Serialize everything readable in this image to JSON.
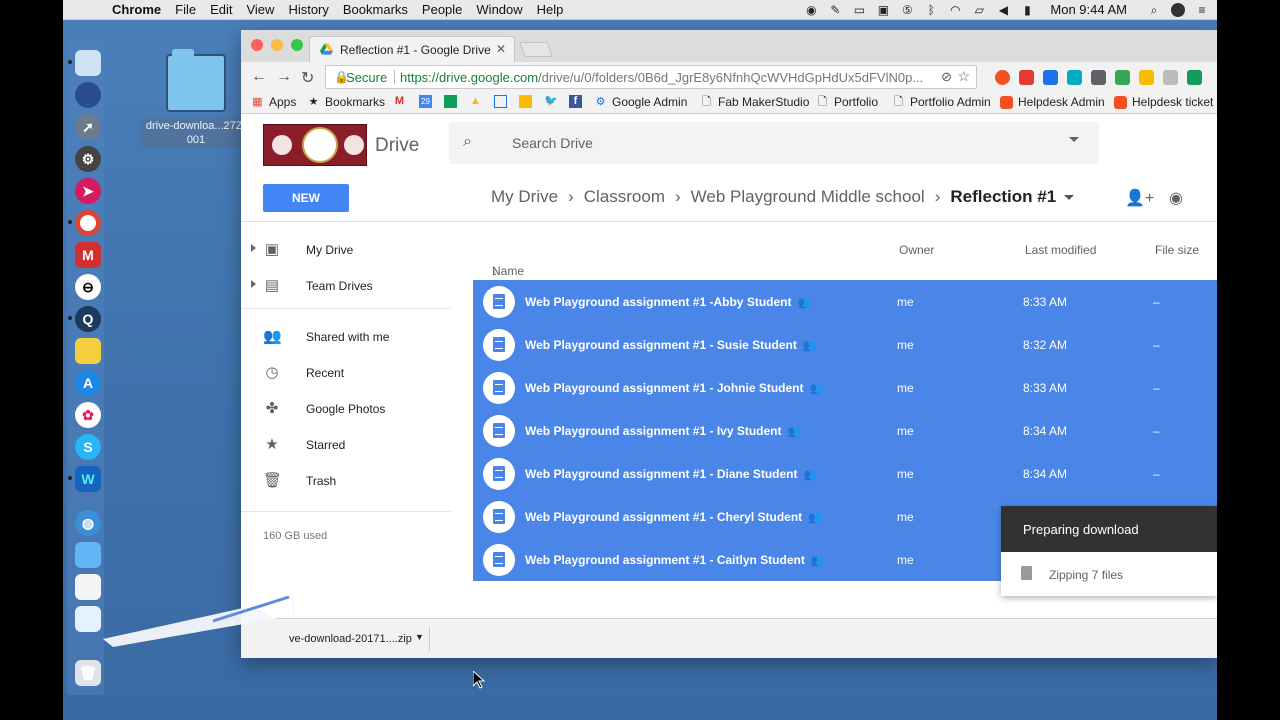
{
  "menubar": {
    "apple_icon": "apple-logo-icon",
    "items": [
      "Chrome",
      "File",
      "Edit",
      "View",
      "History",
      "Bookmarks",
      "People",
      "Window",
      "Help"
    ],
    "clock": "Mon 9:44 AM"
  },
  "desktop": {
    "folder_label": "drive-downloa...27Z-001"
  },
  "browser": {
    "tab_title": "Reflection #1 - Google Drive",
    "tab_close": "✕",
    "secure_label": "Secure",
    "url_host": "https://drive.google.com",
    "url_path": "/drive/u/0/folders/0B6d_JgrE8y6NfnhQcWVHdGpHdUx5dFVlN0p...",
    "bookmarks": [
      {
        "label": "Apps",
        "icon": "apps-grid-icon"
      },
      {
        "label": "Bookmarks",
        "icon": "star-icon"
      },
      {
        "label": "",
        "icon": "gmail-icon"
      },
      {
        "label": "",
        "icon": "calendar-icon"
      },
      {
        "label": "",
        "icon": "classroom-icon"
      },
      {
        "label": "",
        "icon": "drive-icon"
      },
      {
        "label": "",
        "icon": "layout-icon"
      },
      {
        "label": "",
        "icon": "keep-icon"
      },
      {
        "label": "",
        "icon": "twitter-icon"
      },
      {
        "label": "",
        "icon": "facebook-icon"
      },
      {
        "label": "Google Admin",
        "icon": "gear-icon"
      },
      {
        "label": "Fab MakerStudio",
        "icon": "page-icon"
      },
      {
        "label": "Portfolio",
        "icon": "page-icon"
      },
      {
        "label": "Portfolio Admin",
        "icon": "page-icon"
      },
      {
        "label": "Helpdesk Admin",
        "icon": "helpdesk-icon"
      },
      {
        "label": "Helpdesk ticket",
        "icon": "helpdesk-icon"
      }
    ]
  },
  "drive": {
    "title": "Drive",
    "search_placeholder": "Search Drive",
    "new_button": "NEW",
    "breadcrumb": [
      "My Drive",
      "Classroom",
      "Web Playground Middle school"
    ],
    "current_folder": "Reflection #1",
    "breadcrumb_separator": "›",
    "nav": {
      "my_drive": "My Drive",
      "team_drives": "Team Drives",
      "shared": "Shared with me",
      "recent": "Recent",
      "photos": "Google Photos",
      "starred": "Starred",
      "trash": "Trash"
    },
    "storage": "160 GB used",
    "columns": {
      "name": "Name",
      "owner": "Owner",
      "modified": "Last modified",
      "size": "File size"
    },
    "sort_arrow": "↓",
    "files": [
      {
        "name": "Web Playground assignment #1 -Abby Student",
        "owner": "me",
        "modified": "8:33 AM",
        "size": "–"
      },
      {
        "name": "Web Playground assignment #1 - Susie Student",
        "owner": "me",
        "modified": "8:32 AM",
        "size": "–"
      },
      {
        "name": "Web Playground assignment #1 - Johnie Student",
        "owner": "me",
        "modified": "8:33 AM",
        "size": "–"
      },
      {
        "name": "Web Playground assignment #1 - Ivy Student",
        "owner": "me",
        "modified": "8:34 AM",
        "size": "–"
      },
      {
        "name": "Web Playground assignment #1 - Diane Student",
        "owner": "me",
        "modified": "8:34 AM",
        "size": "–"
      },
      {
        "name": "Web Playground assignment #1 - Cheryl Student",
        "owner": "me",
        "modified": "",
        "size": ""
      },
      {
        "name": "Web Playground assignment #1 - Caitlyn Student",
        "owner": "me",
        "modified": "",
        "size": ""
      }
    ],
    "toast": {
      "title": "Preparing download",
      "status": "Zipping 7 files"
    }
  },
  "download_shelf": {
    "file": "ve-download-20171....zip"
  },
  "colors": {
    "selection": "#4a86e8",
    "new_button": "#4285f4",
    "desktop": "#4a7fb9"
  }
}
